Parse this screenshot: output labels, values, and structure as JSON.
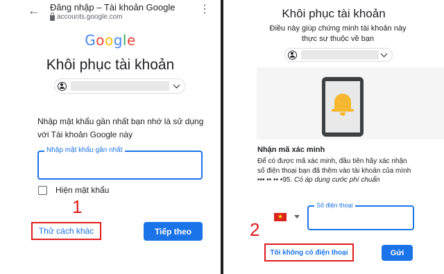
{
  "left": {
    "topbar": {
      "title": "Đăng nhập – Tài khoản Google",
      "url": "accounts.google.com",
      "back_icon": "back-arrow-icon",
      "menu_icon": "more-vert-icon"
    },
    "logo": {
      "letters": [
        "G",
        "o",
        "o",
        "g",
        "l",
        "e"
      ],
      "colors": [
        "#4285f4",
        "#ea4335",
        "#fbbc05",
        "#4285f4",
        "#34a853",
        "#ea4335"
      ]
    },
    "heading": "Khôi phục tài khoản",
    "instruction": "Nhập mật khẩu gần nhất bạn nhớ là sử dụng với Tài khoản Google này",
    "password_field": {
      "label": "Nhập mật khẩu gần nhất",
      "value": ""
    },
    "show_password_label": "Hiện mật khẩu",
    "try_another_label": "Thử cách khác",
    "next_label": "Tiếp theo",
    "step_number": "1"
  },
  "right": {
    "heading": "Khôi phục tài khoản",
    "subtitle": "Điều này giúp chứng minh tài khoản này thực sự thuộc về bạn",
    "section_title": "Nhận mã xác minh",
    "description": "Để có được mã xác minh, đầu tiên hãy xác nhận số điện thoại bạn đã thêm vào tài khoản của mình ••• •• •• •95.",
    "description_note": "Có áp dụng cước phí chuẩn",
    "phone_field": {
      "label": "Số điện thoại",
      "value": ""
    },
    "no_phone_label": "Tôi không có điện thoại",
    "send_label": "Gửi",
    "step_number": "2"
  },
  "colors": {
    "accent": "#1a73e8",
    "highlight": "#e01b1b"
  }
}
